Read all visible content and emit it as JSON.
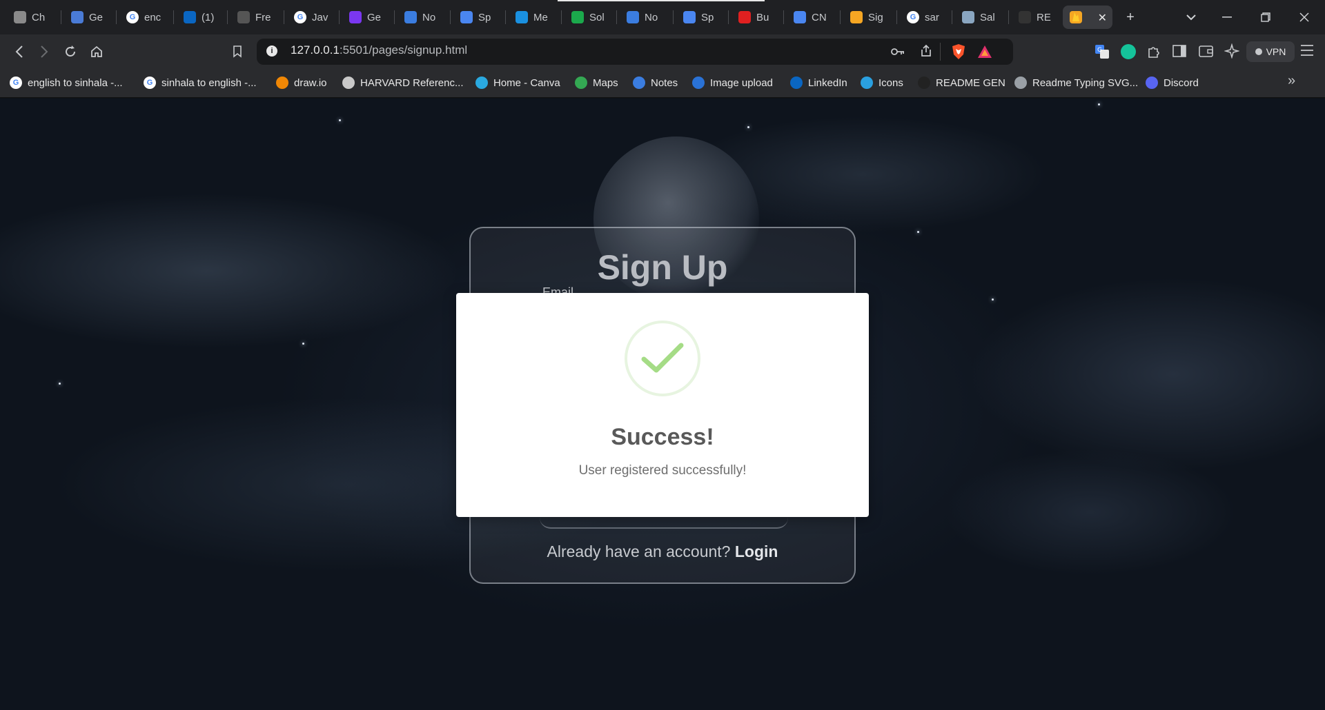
{
  "browser": {
    "tabs": [
      {
        "title": "Ch",
        "icon": "chatgpt-icon",
        "fav": "#8a8a8a"
      },
      {
        "title": "Ge",
        "icon": "gemini-icon",
        "fav": "#4a7bd6"
      },
      {
        "title": "enc",
        "icon": "google-icon",
        "fav": "#ffffff"
      },
      {
        "title": "(1)",
        "icon": "linkedin-icon",
        "fav": "#0a66c2"
      },
      {
        "title": "Fre",
        "icon": "freecodecamp-icon",
        "fav": "#555555"
      },
      {
        "title": "Jav",
        "icon": "google-icon",
        "fav": "#ffffff"
      },
      {
        "title": "Ge",
        "icon": "bootstrap-icon",
        "fav": "#7a37f0"
      },
      {
        "title": "No",
        "icon": "notes-icon",
        "fav": "#3b7de0"
      },
      {
        "title": "Sp",
        "icon": "docs-icon",
        "fav": "#4a86f0"
      },
      {
        "title": "Me",
        "icon": "vuetify-icon",
        "fav": "#1a90e0"
      },
      {
        "title": "Sol",
        "icon": "hackerrank-icon",
        "fav": "#1ba94c"
      },
      {
        "title": "No",
        "icon": "notes-icon",
        "fav": "#3b7de0"
      },
      {
        "title": "Sp",
        "icon": "docs-icon",
        "fav": "#4a86f0"
      },
      {
        "title": "Bu",
        "icon": "bu-icon",
        "fav": "#e02020"
      },
      {
        "title": "CN",
        "icon": "docs-icon",
        "fav": "#4a86f0"
      },
      {
        "title": "Sig",
        "icon": "firebase-icon",
        "fav": "#f5a623"
      },
      {
        "title": "sar",
        "icon": "github-icon",
        "fav": "#ffffff"
      },
      {
        "title": "Sal",
        "icon": "image-icon",
        "fav": "#8aa6c1"
      },
      {
        "title": "RE",
        "icon": "readme-icon",
        "fav": "#333333"
      }
    ],
    "active_tab_icon": "firebase-icon",
    "active_tab_close": "✕",
    "new_tab": "+",
    "url_host": "127.0.0.1",
    "url_rest": ":5501/pages/signup.html",
    "vpn_label": "VPN",
    "bookmarks": [
      {
        "label": "english to sinhala -...",
        "icon": "google-icon",
        "fav": "#ffffff"
      },
      {
        "label": "sinhala to english -...",
        "icon": "google-icon",
        "fav": "#ffffff"
      },
      {
        "label": "draw.io",
        "icon": "drawio-icon",
        "fav": "#f08705"
      },
      {
        "label": "HARVARD Referenc...",
        "icon": "book-icon",
        "fav": "#c9c9c9"
      },
      {
        "label": "Home - Canva",
        "icon": "canva-icon",
        "fav": "#2aa9e0"
      },
      {
        "label": "Maps",
        "icon": "maps-icon",
        "fav": "#34a853"
      },
      {
        "label": "Notes",
        "icon": "notes-icon",
        "fav": "#3b7de0"
      },
      {
        "label": "Image upload",
        "icon": "imgbb-icon",
        "fav": "#2a72d6"
      },
      {
        "label": "LinkedIn",
        "icon": "linkedin-icon",
        "fav": "#0a66c2"
      },
      {
        "label": "Icons",
        "icon": "icons-icon",
        "fav": "#2aa0e0"
      },
      {
        "label": "README GEN",
        "icon": "readme-icon",
        "fav": "#222222"
      },
      {
        "label": "Readme Typing SVG...",
        "icon": "keyboard-icon",
        "fav": "#9aa0a6"
      },
      {
        "label": "Discord",
        "icon": "discord-icon",
        "fav": "#5865f2"
      }
    ],
    "more_bookmarks": "»"
  },
  "signup": {
    "title": "Sign Up",
    "email_label": "Email",
    "login_prompt": "Already have an account?",
    "login_link": "Login"
  },
  "modal": {
    "icon": "success-check-icon",
    "title": "Success!",
    "message": "User registered successfully!",
    "check_color": "#a5dc86"
  }
}
